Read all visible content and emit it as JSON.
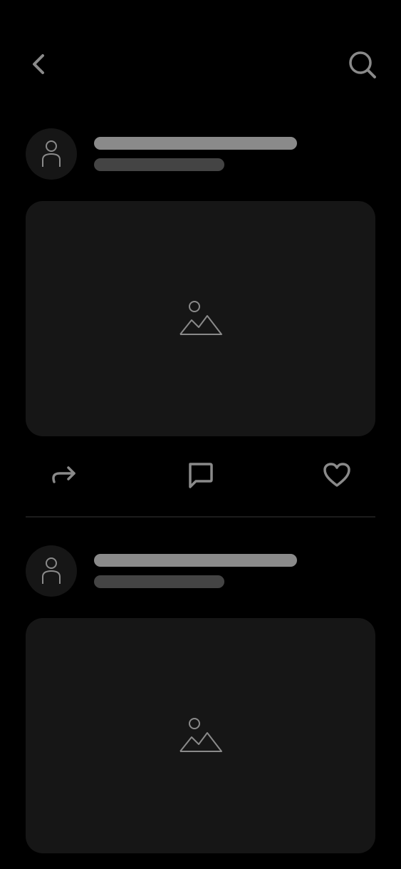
{
  "header": {
    "back_icon": "chevron-left-icon",
    "search_icon": "search-icon"
  },
  "feed": {
    "post_count_visible": 2,
    "posts": [
      {
        "avatar_icon": "user-icon",
        "media_icon": "image-placeholder-icon",
        "actions": [
          "share-icon",
          "comment-icon",
          "heart-icon"
        ]
      },
      {
        "avatar_icon": "user-icon",
        "media_icon": "image-placeholder-icon"
      }
    ]
  },
  "colors": {
    "background": "#000000",
    "surface": "#161616",
    "icon": "#8a8a8a",
    "skeleton_primary": "#8a8a8a",
    "skeleton_secondary": "#444444",
    "divider": "#1c1c1c"
  }
}
